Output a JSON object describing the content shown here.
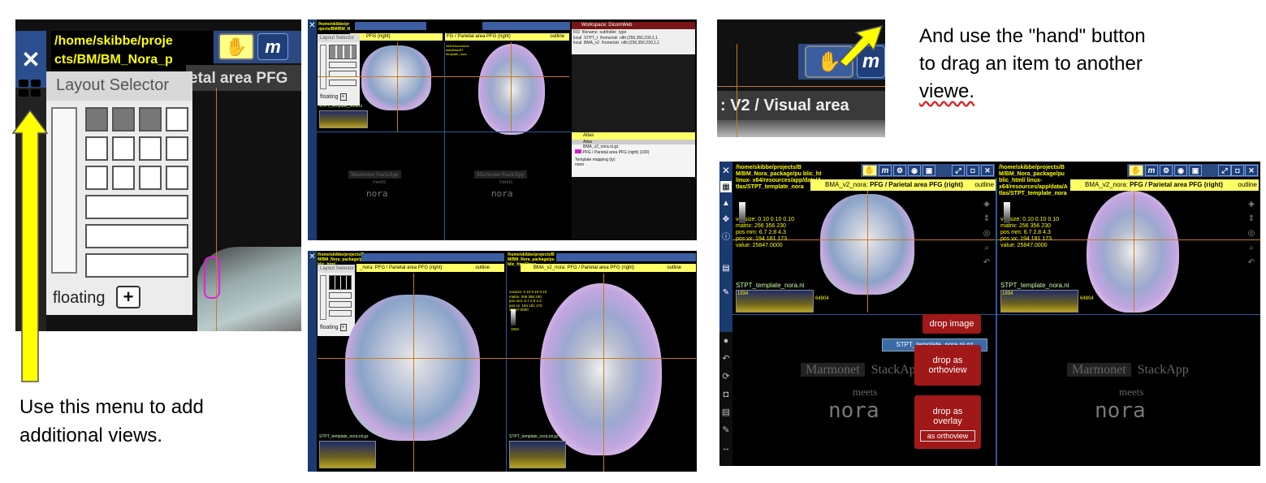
{
  "panel1": {
    "path_line1": "/home/skibbe/proje",
    "path_line2": "cts/BM/BM_Nora_p",
    "m_label": "m",
    "title_fragment": "etal area PFG",
    "layout_selector_label": "Layout Selector",
    "floating_label": "floating",
    "plus_label": "+"
  },
  "note_left": {
    "line1": "Use this menu to add",
    "line2": "additional views."
  },
  "panel2": {
    "path": "/home/skibbe/pr ojects/BM/BM_N",
    "title_left": "PFG (right)",
    "title_right": "FG / Parietal area PFG (right)",
    "outline": "outline",
    "layout_selector_label": "Layout Selector",
    "floating_label": "floating",
    "workspace_title": "Workspace: DicomWeb",
    "ws_headers": [
      "FID",
      "filename",
      "subfolder",
      "type"
    ],
    "ws_rows": [
      [
        "local",
        "STPT_t",
        "/home/ski",
        "nifti  (256,356,230,1,1"
      ],
      [
        "local",
        "BMA_v2",
        "/home/ski",
        "nifti  (256,356,230,1,1"
      ]
    ],
    "atlas_title": "Atlas",
    "atlas_sub": "Atlas",
    "atlas_file": "BMA_v2_nora.ni.gz",
    "atlas_region": "PFG / Parietal area PFG (right) (100)",
    "template_mapping": "Template mapping (ty)",
    "template_value": "none",
    "info_lines": [
      "voxsize",
      "0.10 0.10 0.10",
      "mm",
      "256 356 230",
      "pos mm",
      "6.7 2.8 4.3",
      "pos vx",
      "194 181 173",
      "value: 25847.0000"
    ],
    "info_path": "x64/resources/a dat/Atlas/ST template_nora",
    "hist_file": "STPT_template_nora.ni",
    "marmonet": "Marmonet",
    "stackapp": "StackApp",
    "meets": "meets",
    "nora": "nora"
  },
  "panel3": {
    "path": "/home/skibbe/projects/B M/BM_Nora_package/pu blic_html",
    "path_right": "/home/skibbe/projects/B M/BM_Nora_package/pu blic_html/linux-",
    "title_left": "_nora: PFG / Parietal area PFG (right)",
    "title_right": "BMA_v2_nora: PFG / Parietal area PFG (right)",
    "outline": "outline",
    "layout_selector_label": "Layout Selector",
    "floating_label": "floating",
    "info_lines": [
      "voxsize: 0.10 0.10 0.10",
      "matrix: 256 356 230",
      "pos mm: 6.7 2.8 4.3",
      "pos vx: 194 181 173",
      "25847.0000"
    ],
    "info_path": "x64/resources/app/data/A tlas/STPT_template_nora .ni.gz",
    "hist_file_left": "STPT_template_nora.nii.gz",
    "hist_file_right": "STPT_template_nora.nii.gz",
    "cb_value": "1934"
  },
  "panel4": {
    "m_label": "m",
    "title_fragment": ": V2 / Visual area"
  },
  "note_right": {
    "line1": "And use the \"hand\" button",
    "line2": "to drag an item to another",
    "line3": "viewe."
  },
  "panel5": {
    "path_left": "/home/skibbe/projects/B M/BM_Nora_package/pu blic_ht linux- x64/resources/app/data/A tlas/STPT_template_nora",
    "path_right": "/home/skibbe/projects/B M/BM_Nora_package/pu blic_html/ linux- x64/resources/app/data/A tlas/STPT_template_nora",
    "title_left": "BMA_v2_nora:",
    "title_left_bold": "PFG / Parietal area PFG (right)",
    "title_right": "BMA_v2_nora:",
    "title_right_bold": "PFG / Parietal area PFG (right)",
    "outline": "outline",
    "info_left": [
      "voxsize: 0.10 0.10 0.10",
      "matrix: 256 356 230",
      "pos mm: 6.7 2.8 4.3",
      "pos vx: 194 181 173",
      "value: 25847.0000"
    ],
    "info_right": [
      "voxsize: 0.10 0.10 0.10",
      "matrix: 256 356 230",
      "pos mm: 6.7 2.8 4.3",
      "pos vx: 194 181 173",
      "value: 25847.0000"
    ],
    "hist_file_left": "STPT_template_nora.ni",
    "hist_file_right": "STPT_template_nora.ni",
    "hist_min": "1934",
    "hist_max": "64804",
    "drop_image": "drop image",
    "drag_item": "STPT_template_nora.ni.gz",
    "drop_orthoview_1": "drop as",
    "drop_orthoview_2": "orthoview",
    "drop_overlay_1": "drop as",
    "drop_overlay_2": "overlay",
    "as_orthoview": "as orthoview",
    "marmonet": "Marmonet",
    "stackapp": "StackApp",
    "meets": "meets",
    "nora": "nora"
  },
  "colors": {
    "arrow_yellow": "#ffff00",
    "path_yellow": "#ffff00",
    "toolbar_blue": "#1f3f7a",
    "drop_red": "#a01818",
    "crosshair": "#c87a20"
  }
}
